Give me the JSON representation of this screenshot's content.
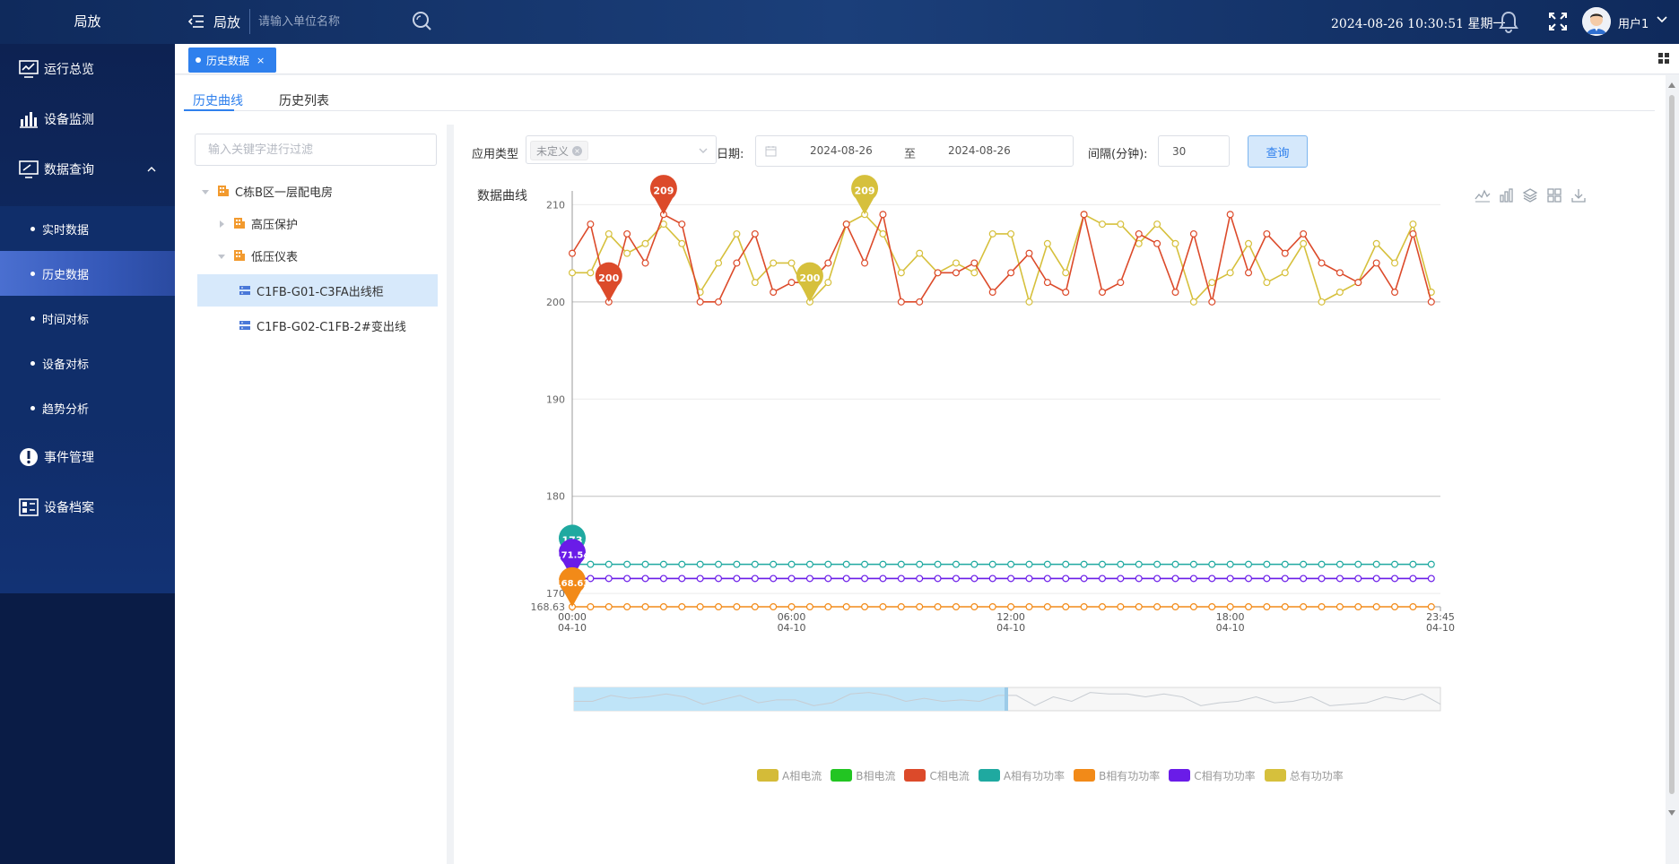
{
  "topbar": {
    "brand": "局放",
    "title": "局放",
    "search_placeholder": "请输入单位名称",
    "datetime": "2024-08-26 10:30:51 星期一",
    "user": "用户1"
  },
  "sidebar": {
    "items": [
      {
        "label": "运行总览",
        "icon": "monitor-chart-icon"
      },
      {
        "label": "设备监测",
        "icon": "bar-chart-icon"
      },
      {
        "label": "数据查询",
        "icon": "screen-icon"
      },
      {
        "label": "事件管理",
        "icon": "alert-icon"
      },
      {
        "label": "设备档案",
        "icon": "archive-icon"
      }
    ],
    "subitems": [
      {
        "label": "实时数据"
      },
      {
        "label": "历史数据"
      },
      {
        "label": "时间对标"
      },
      {
        "label": "设备对标"
      },
      {
        "label": "趋势分析"
      }
    ],
    "active_sub": "历史数据"
  },
  "tabs": {
    "open_tab": "历史数据",
    "close_glyph": "×"
  },
  "subtabs": [
    "历史曲线",
    "历史列表"
  ],
  "tree": {
    "filter_placeholder": "输入关键字进行过滤",
    "nodes": [
      {
        "label": "C栋B区一层配电房"
      },
      {
        "label": "高压保护"
      },
      {
        "label": "低压仪表"
      },
      {
        "label": "C1FB-G01-C3FA出线柜"
      },
      {
        "label": "C1FB-G02-C1FB-2#变出线"
      }
    ]
  },
  "query": {
    "type_label": "应用类型",
    "type_tag": "未定义",
    "date_label": "日期:",
    "date_start": "2024-08-26",
    "date_sep": "至",
    "date_end": "2024-08-26",
    "interval_label": "间隔(分钟):",
    "interval_value": "30",
    "query_button": "查询"
  },
  "chart_data": {
    "type": "line",
    "title": "数据曲线",
    "x_ticks": [
      {
        "time": "00:00",
        "date": "04-10",
        "t": 0
      },
      {
        "time": "06:00",
        "date": "04-10",
        "t": 12
      },
      {
        "time": "12:00",
        "date": "04-10",
        "t": 24
      },
      {
        "time": "18:00",
        "date": "04-10",
        "t": 36
      },
      {
        "time": "23:45",
        "date": "04-10",
        "t": 47.5
      }
    ],
    "y_ticks": [
      170,
      180,
      190,
      200,
      210
    ],
    "y_min_label": "168.63",
    "ylim": [
      168.63,
      210.5
    ],
    "series": [
      {
        "name": "A相电流",
        "color": "#d4bb38",
        "values": []
      },
      {
        "name": "B相电流",
        "color": "#22c522",
        "values": []
      },
      {
        "name": "C相电流",
        "color": "#dc4a2a",
        "values": [
          205,
          208,
          200,
          207,
          204,
          209,
          208,
          200,
          200,
          204,
          207,
          201,
          202,
          202,
          204,
          208,
          204,
          209,
          200,
          200,
          203,
          203,
          204,
          201,
          203,
          205,
          202,
          201,
          209,
          201,
          202,
          207,
          206,
          201,
          207,
          200,
          209,
          203,
          207,
          205,
          207,
          204,
          203,
          202,
          204,
          201,
          207,
          200
        ]
      },
      {
        "name": "A相有功功率",
        "color": "#1fa9a0",
        "values": [
          173,
          173,
          173,
          173,
          173,
          173,
          173,
          173,
          173,
          173,
          173,
          173,
          173,
          173,
          173,
          173,
          173,
          173,
          173,
          173,
          173,
          173,
          173,
          173,
          173,
          173,
          173,
          173,
          173,
          173,
          173,
          173,
          173,
          173,
          173,
          173,
          173,
          173,
          173,
          173,
          173,
          173,
          173,
          173,
          173,
          173,
          173,
          173
        ]
      },
      {
        "name": "B相有功功率",
        "color": "#f28a18",
        "values": [
          168.63,
          168.63,
          168.63,
          168.63,
          168.63,
          168.63,
          168.63,
          168.63,
          168.63,
          168.63,
          168.63,
          168.63,
          168.63,
          168.63,
          168.63,
          168.63,
          168.63,
          168.63,
          168.63,
          168.63,
          168.63,
          168.63,
          168.63,
          168.63,
          168.63,
          168.63,
          168.63,
          168.63,
          168.63,
          168.63,
          168.63,
          168.63,
          168.63,
          168.63,
          168.63,
          168.63,
          168.63,
          168.63,
          168.63,
          168.63,
          168.63,
          168.63,
          168.63,
          168.63,
          168.63,
          168.63,
          168.63,
          168.63
        ]
      },
      {
        "name": "C相有功功率",
        "color": "#6a1ce8",
        "values": [
          171.54,
          171.54,
          171.54,
          171.54,
          171.54,
          171.54,
          171.54,
          171.54,
          171.54,
          171.54,
          171.54,
          171.54,
          171.54,
          171.54,
          171.54,
          171.54,
          171.54,
          171.54,
          171.54,
          171.54,
          171.54,
          171.54,
          171.54,
          171.54,
          171.54,
          171.54,
          171.54,
          171.54,
          171.54,
          171.54,
          171.54,
          171.54,
          171.54,
          171.54,
          171.54,
          171.54,
          171.54,
          171.54,
          171.54,
          171.54,
          171.54,
          171.54,
          171.54,
          171.54,
          171.54,
          171.54,
          171.54,
          171.54
        ]
      },
      {
        "name": "总有功功率",
        "color": "#d6c03c",
        "values": [
          203,
          203,
          207,
          205,
          206,
          208,
          206,
          201,
          204,
          207,
          202,
          204,
          204,
          200,
          202,
          208,
          209,
          207,
          203,
          205,
          203,
          204,
          203,
          207,
          207,
          200,
          206,
          203,
          209,
          208,
          208,
          206,
          208,
          206,
          200,
          202,
          203,
          206,
          202,
          203,
          206,
          200,
          201,
          202,
          206,
          204,
          208,
          201
        ]
      }
    ],
    "markers": [
      {
        "series": "C相电流",
        "index": 5,
        "label": "209"
      },
      {
        "series": "C相电流",
        "index": 2,
        "label": "200"
      },
      {
        "series": "总有功功率",
        "index": 16,
        "label": "209"
      },
      {
        "series": "总有功功率",
        "index": 13,
        "label": "200"
      },
      {
        "series": "A相有功功率",
        "index": 0,
        "label": "173"
      },
      {
        "series": "C相有功功率",
        "index": 0,
        "label": "171.54"
      },
      {
        "series": "B相有功功率",
        "index": 0,
        "label": "168.63"
      }
    ],
    "legend_position": "bottom",
    "grid": true
  }
}
